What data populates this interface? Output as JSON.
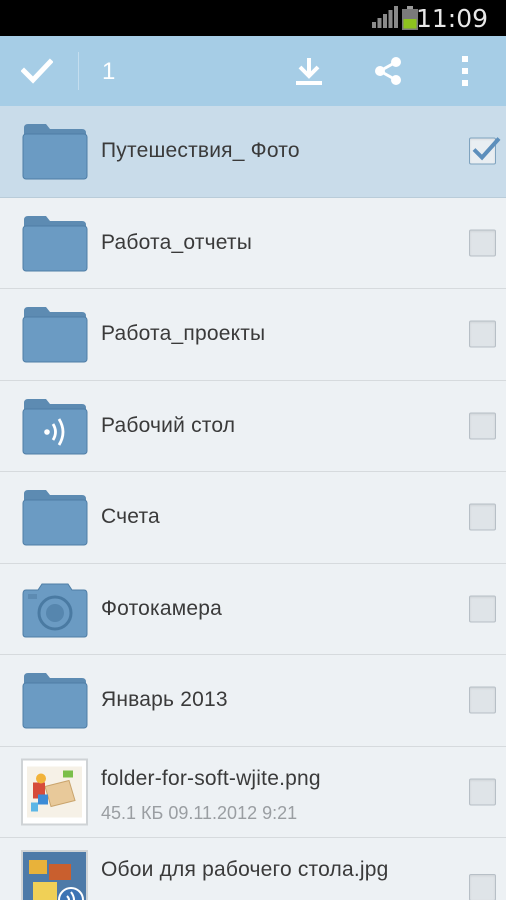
{
  "status": {
    "time": "11:09",
    "signal_icon": "signal-icon",
    "battery_icon": "battery-icon"
  },
  "actionbar": {
    "selected_count": "1",
    "done_icon": "checkmark-icon",
    "actions": [
      {
        "name": "download",
        "icon": "download-icon"
      },
      {
        "name": "share",
        "icon": "share-icon"
      },
      {
        "name": "more",
        "icon": "overflow-menu-icon"
      }
    ]
  },
  "items": [
    {
      "title": "Путешествия_ Фото",
      "icon": "folder-icon",
      "checked": true
    },
    {
      "title": "Работа_отчеты",
      "icon": "folder-icon",
      "checked": false
    },
    {
      "title": "Работа_проекты",
      "icon": "folder-icon",
      "checked": false
    },
    {
      "title": "Рабочий стол",
      "icon": "shared-folder-icon",
      "checked": false
    },
    {
      "title": "Счета",
      "icon": "folder-icon",
      "checked": false
    },
    {
      "title": "Фотокамера",
      "icon": "camera-folder-icon",
      "checked": false
    },
    {
      "title": "Январь 2013",
      "icon": "folder-icon",
      "checked": false
    },
    {
      "title": "folder-for-soft-wjite.png",
      "meta": "45.1 КБ 09.11.2012 9:21",
      "icon": "image-thumbnail",
      "checked": false
    },
    {
      "title": "Обои для рабочего стола.jpg",
      "meta": "",
      "icon": "image-thumbnail",
      "checked": false
    }
  ],
  "colors": {
    "accent": "#a6cde6",
    "folder": "#6b9bc3",
    "selected_row": "#c9dcea",
    "background": "#edf1f4"
  }
}
